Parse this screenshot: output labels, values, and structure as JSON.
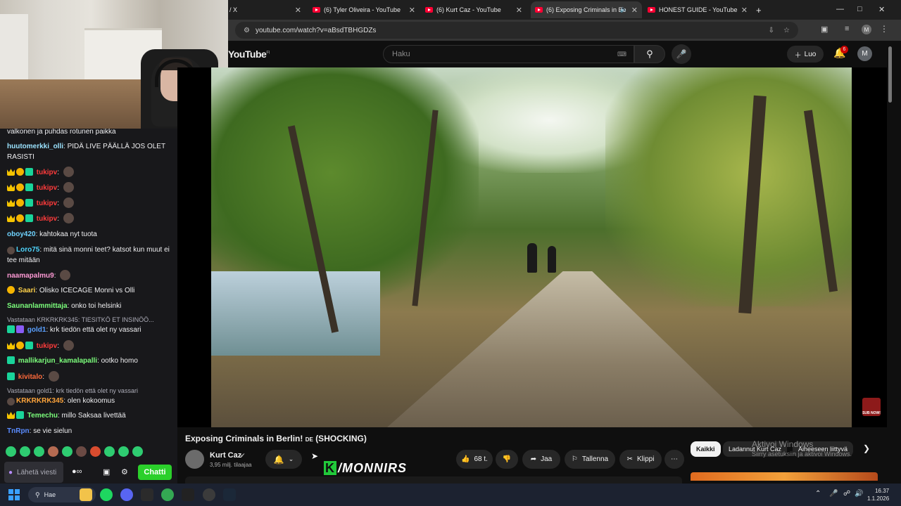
{
  "browser": {
    "tabs": [
      {
        "label": "/ X",
        "active": false
      },
      {
        "label": "(6) Tyler Oliveira - YouTube",
        "active": false
      },
      {
        "label": "(6) Kurt Caz - YouTube",
        "active": false
      },
      {
        "label": "(6) Exposing Criminals in Be",
        "active": true
      },
      {
        "label": "HONEST GUIDE - YouTube",
        "active": false
      }
    ],
    "new_tab": "+",
    "url": "youtube.com/watch?v=aBsdTBHGDZs",
    "profile_initial": "M"
  },
  "chat": {
    "messages": [
      {
        "user": "",
        "text": "valkonen ja puhdas rotunen paikka"
      },
      {
        "user": "huutomerkki_olli",
        "text": "PIDÄ LIVE PÄÄLLÄ JOS OLET RASISTI"
      },
      {
        "user": "tukipv",
        "text": ""
      },
      {
        "user": "tukipv",
        "text": ""
      },
      {
        "user": "tukipv",
        "text": ""
      },
      {
        "user": "tukipv",
        "text": ""
      },
      {
        "user": "oboy420",
        "text": "kahtokaa nyt tuota"
      },
      {
        "user": "Loro75",
        "text": "mitä sinä monni teet? katsot kun muut ei tee mitään"
      },
      {
        "user": "naamapalmu9",
        "text": ""
      },
      {
        "user": "Saari",
        "text": "Olisko ICECAGE Monni vs Olli"
      },
      {
        "user": "Saunanlammittaja",
        "text": "onko toi helsinki"
      },
      {
        "reply": "Vastataan KRKRKRK345: TIESITKÖ ET INSINÖÖ..."
      },
      {
        "user": "gold1",
        "text": "krk tiedön että olet ny vassari"
      },
      {
        "user": "tukipv",
        "text": ""
      },
      {
        "user": "mallikarjun_kamalapalli",
        "text": "ootko homo"
      },
      {
        "user": "kivitalo",
        "text": ""
      },
      {
        "reply": "Vastataan gold1: krk tiedön että olet ny vassari"
      },
      {
        "user": "KRKRKRK345",
        "text": "olen kokoomus"
      },
      {
        "user": "Temechu",
        "text": "millo Saksaa livettää"
      },
      {
        "user": "TnRpn",
        "text": "se vie sielun"
      }
    ],
    "input_placeholder": "Lähetä viesti",
    "send_label": "Chatti",
    "colors": {
      "green": "#2bd02b",
      "bg": "#18181b"
    }
  },
  "youtube": {
    "logo": "YouTube",
    "region": "FI",
    "search_placeholder": "Haku",
    "create_label": "Luo",
    "notification_count": "6",
    "account_initial": "M",
    "sub_now": "SUB NOW!",
    "video_title": "Exposing Criminals in Berlin!",
    "title_flag": "DE",
    "title_suffix": "(SHOCKING)",
    "channel": "Kurt Caz",
    "subscribers": "3,95 milj. tilaajaa",
    "likes": "68 t.",
    "share": "Jaa",
    "save": "Tallenna",
    "clip": "Klippi",
    "chips": [
      "Kaikki",
      "Ladannut Kurt Caz",
      "Aiheeseen liittyvä"
    ],
    "overlay_brand": "/MONNIRS",
    "overlay_k": "K",
    "activate_title": "Aktivoi Windows",
    "activate_sub": "Siirry asetuksiin ja aktivoi Windows."
  },
  "taskbar": {
    "search_label": "Hae",
    "time": "16.37",
    "date": "1.1.2026"
  }
}
